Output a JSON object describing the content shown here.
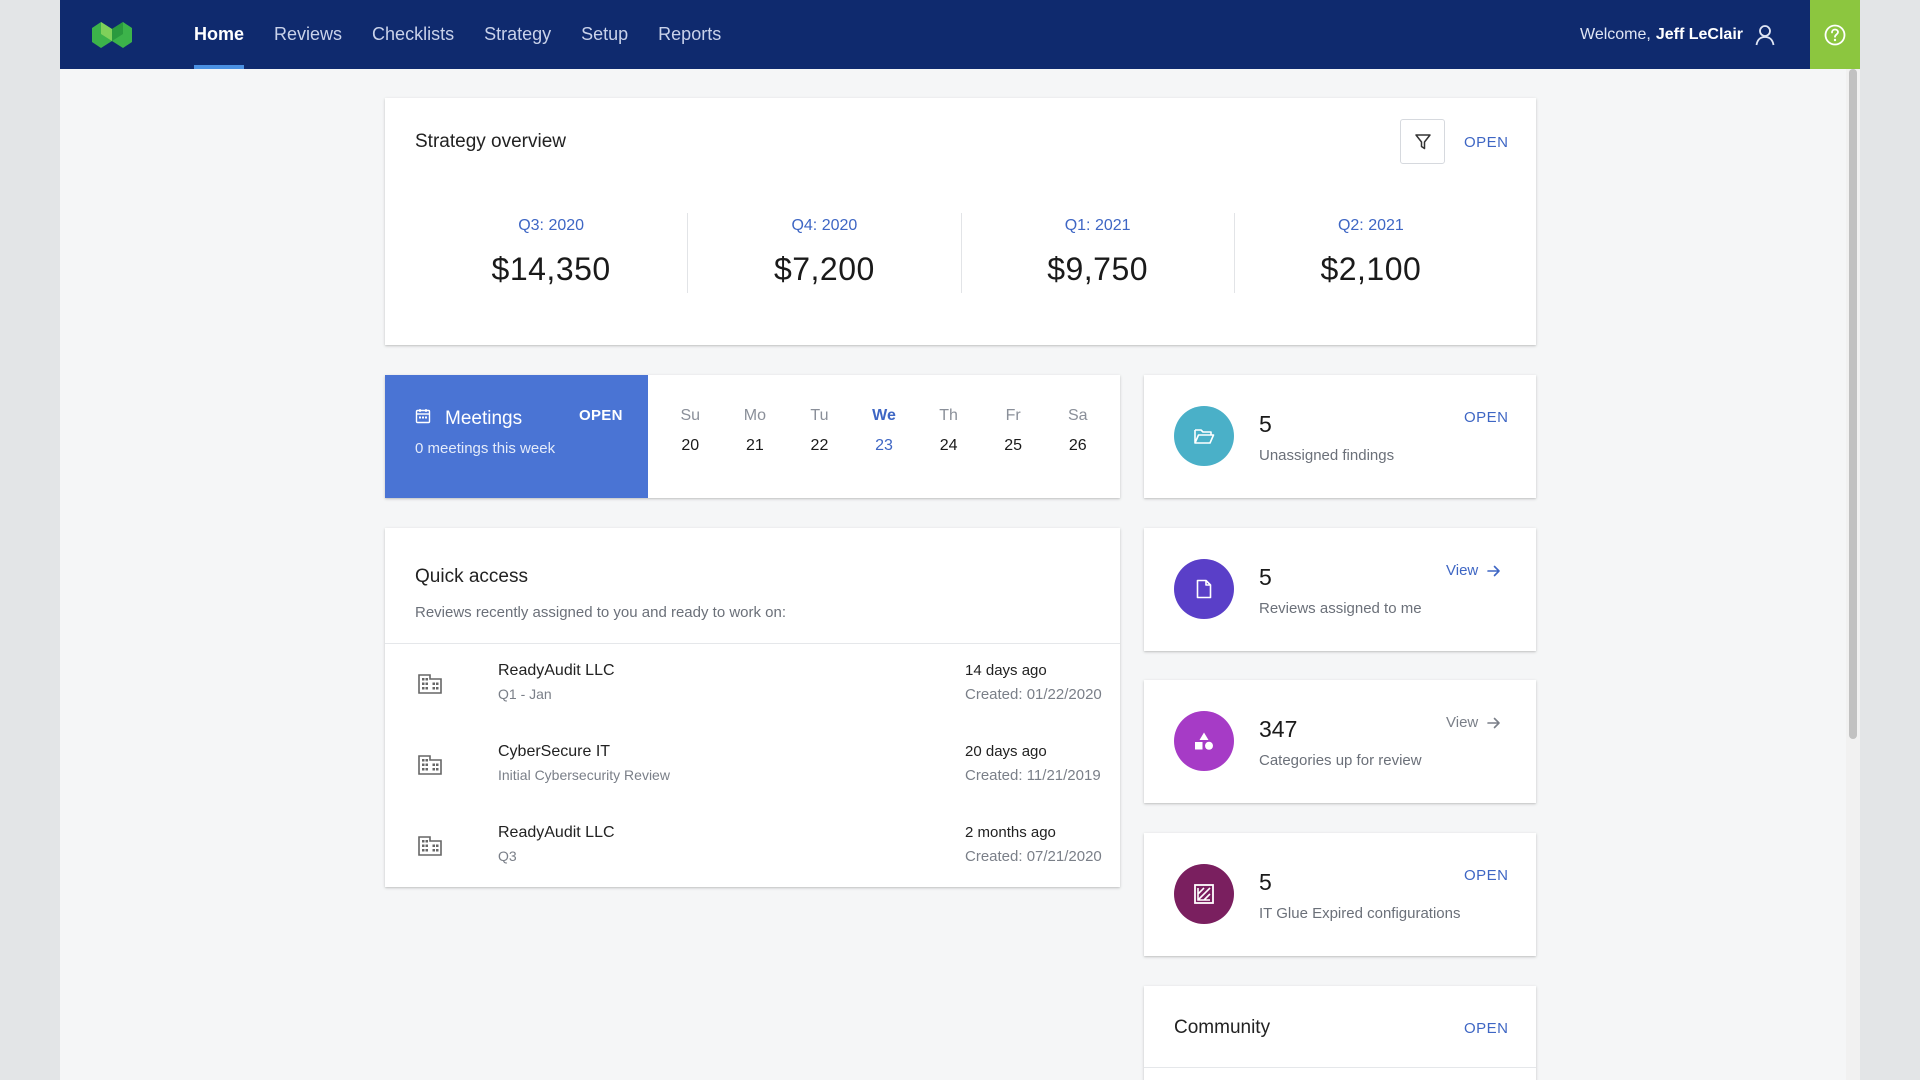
{
  "nav": {
    "items": [
      {
        "label": "Home",
        "active": true
      },
      {
        "label": "Reviews"
      },
      {
        "label": "Checklists"
      },
      {
        "label": "Strategy"
      },
      {
        "label": "Setup"
      },
      {
        "label": "Reports"
      }
    ],
    "welcome_prefix": "Welcome,",
    "user_name": "Jeff LeClair"
  },
  "colors": {
    "topbar": "#0f2a6e",
    "accent": "#3e66c4",
    "help": "#8cc63f",
    "meetings": "#4a74d4"
  },
  "strategy": {
    "title": "Strategy overview",
    "open_label": "OPEN",
    "quarters": [
      {
        "label": "Q3: 2020",
        "value": "$14,350"
      },
      {
        "label": "Q4: 2020",
        "value": "$7,200"
      },
      {
        "label": "Q1: 2021",
        "value": "$9,750"
      },
      {
        "label": "Q2: 2021",
        "value": "$2,100"
      }
    ]
  },
  "meetings": {
    "title": "Meetings",
    "open_label": "OPEN",
    "subtitle": "0 meetings this week",
    "days": [
      {
        "name": "Su",
        "date": "20"
      },
      {
        "name": "Mo",
        "date": "21"
      },
      {
        "name": "Tu",
        "date": "22"
      },
      {
        "name": "We",
        "date": "23",
        "today": true
      },
      {
        "name": "Th",
        "date": "24"
      },
      {
        "name": "Fr",
        "date": "25"
      },
      {
        "name": "Sa",
        "date": "26"
      }
    ]
  },
  "quick_access": {
    "title": "Quick access",
    "description": "Reviews recently assigned to you and ready to work on:",
    "items": [
      {
        "name": "ReadyAudit LLC",
        "sub": "Q1 - Jan",
        "ago": "14 days ago",
        "created": "Created: 01/22/2020"
      },
      {
        "name": "CyberSecure IT",
        "sub": "Initial Cybersecurity Review",
        "ago": "20 days ago",
        "created": "Created: 11/21/2019"
      },
      {
        "name": "ReadyAudit LLC",
        "sub": "Q3",
        "ago": "2 months ago",
        "created": "Created: 07/21/2020"
      }
    ]
  },
  "stats": [
    {
      "count": "5",
      "label": "Unassigned findings",
      "action": "OPEN",
      "icon": "folder-open-icon",
      "color": "#4ab0c8"
    },
    {
      "count": "5",
      "label": "Reviews assigned to me",
      "action": "View",
      "icon": "document-icon",
      "color": "#5a3fc8"
    },
    {
      "count": "347",
      "label": "Categories up for review",
      "action": "View",
      "icon": "shapes-icon",
      "color": "#a63bc6"
    },
    {
      "count": "5",
      "label": "IT Glue Expired configurations",
      "action": "OPEN",
      "icon": "it-glue-icon",
      "color": "#7a1f5f"
    }
  ],
  "community": {
    "title": "Community",
    "open_label": "OPEN"
  }
}
